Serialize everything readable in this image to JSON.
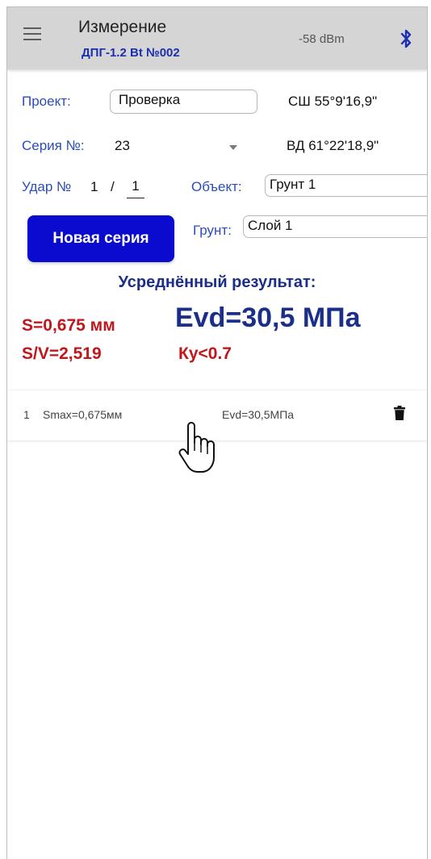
{
  "header": {
    "title": "Измерение",
    "device": "ДПГ-1.2 Bt №002",
    "rssi": "-58 dBm",
    "icons": {
      "menu": "menu-icon",
      "bluetooth": "bluetooth-icon"
    }
  },
  "form": {
    "project_label": "Проект:",
    "project_value": "Проверка",
    "latitude": "СШ 55°9'16,9\"",
    "series_label": "Серия №:",
    "series_value": "23",
    "longitude": "ВД 61°22'18,9\"",
    "strike_label": "Удар №",
    "strike_current": "1",
    "strike_sep": "/",
    "strike_total": "1",
    "object_label": "Объект:",
    "object_value": "Грунт 1",
    "soil_label": "Грунт:",
    "soil_value": "Слой 1",
    "new_series_button": "Новая серия"
  },
  "result": {
    "title": "Усреднённый результат:",
    "s": "S=0,675 мм",
    "sv": "S/V=2,519",
    "evd": "Evd=30,5 МПа",
    "ky": "Ку<0.7"
  },
  "list": [
    {
      "index": "1",
      "smax": "Smax=0,675мм",
      "evd": "Evd=30,5МПа"
    }
  ],
  "colors": {
    "appbar": "#d5d5d5",
    "accent_blue": "#1b2f8a",
    "label_blue": "#2b4db8",
    "button_blue": "#0b0bcf",
    "result_red": "#c0161c"
  }
}
